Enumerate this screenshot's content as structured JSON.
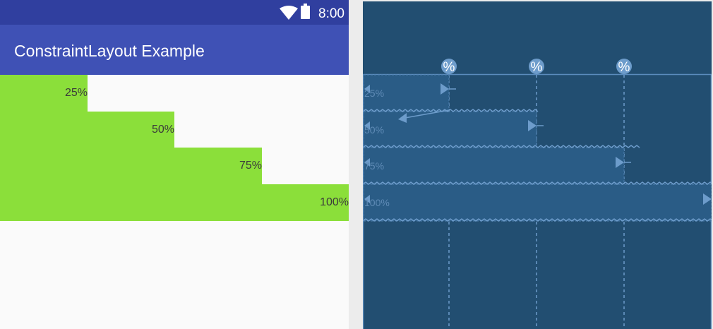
{
  "status_bar": {
    "time": "8:00"
  },
  "app_bar": {
    "title": "ConstraintLayout Example"
  },
  "bars": [
    {
      "label": "25%",
      "percent": 25
    },
    {
      "label": "50%",
      "percent": 50
    },
    {
      "label": "75%",
      "percent": 75
    },
    {
      "label": "100%",
      "percent": 100
    }
  ],
  "blueprint": {
    "guideline_percents": [
      25,
      50,
      75
    ],
    "guideline_icon_label": "%"
  },
  "colors": {
    "status_bar": "#303F9F",
    "app_bar": "#3F51B5",
    "bar_fill": "#8BDF3A",
    "blueprint_bg": "#224E71",
    "blueprint_line": "#6d9ccb"
  }
}
